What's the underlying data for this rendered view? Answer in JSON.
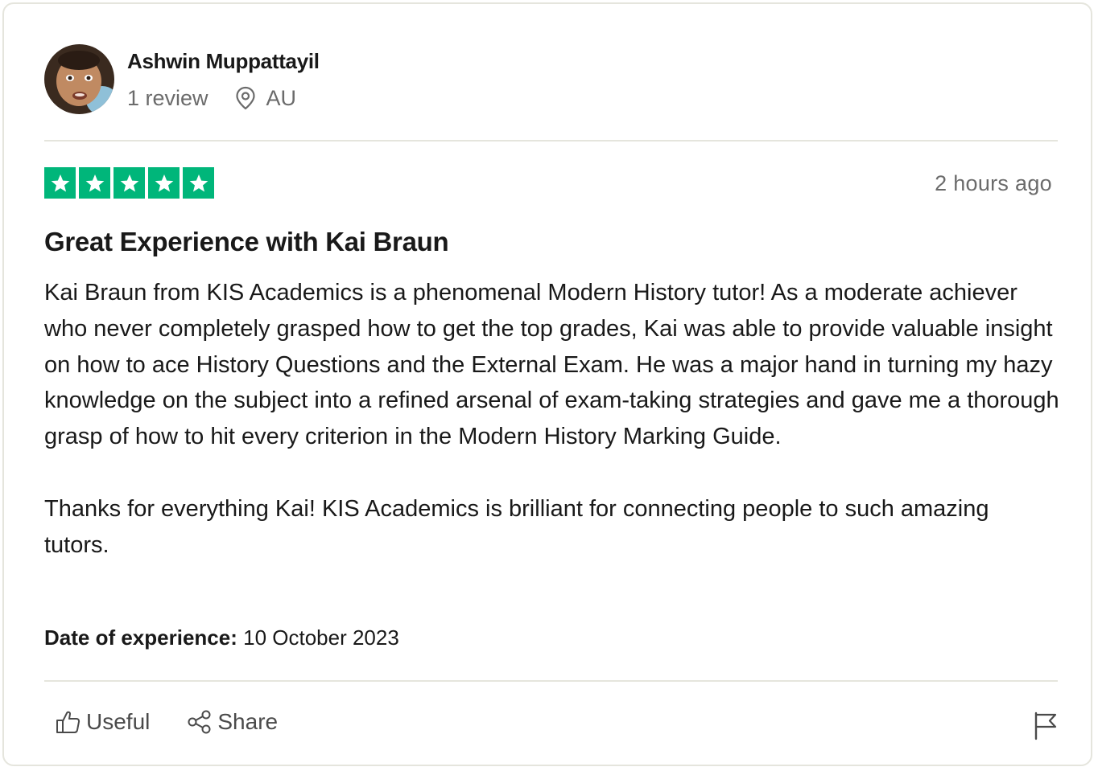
{
  "author": {
    "name": "Ashwin Muppattayil",
    "review_count": "1 review",
    "country": "AU"
  },
  "rating": {
    "stars": 5,
    "max": 5,
    "color": "#00b67a"
  },
  "time_ago": "2 hours ago",
  "review": {
    "title": "Great Experience with Kai Braun",
    "paragraphs": [
      "Kai Braun from KIS Academics is a phenomenal Modern History tutor! As a moderate achiever who never completely grasped how to get the top grades, Kai was able to provide valuable insight on how to ace History Questions and the External Exam. He was a major hand in turning my hazy knowledge on the subject into a refined arsenal of exam-taking strategies and gave me a thorough grasp of how to hit every criterion in the Modern History Marking Guide.",
      "Thanks for everything Kai! KIS Academics is brilliant for connecting people to such amazing tutors."
    ]
  },
  "experience": {
    "label": "Date of experience:",
    "date": "10 October 2023"
  },
  "actions": {
    "useful": "Useful",
    "share": "Share"
  },
  "icons": {
    "location": "location-pin-icon",
    "useful": "thumbs-up-icon",
    "share": "share-icon",
    "report": "flag-icon",
    "star": "star-icon"
  }
}
